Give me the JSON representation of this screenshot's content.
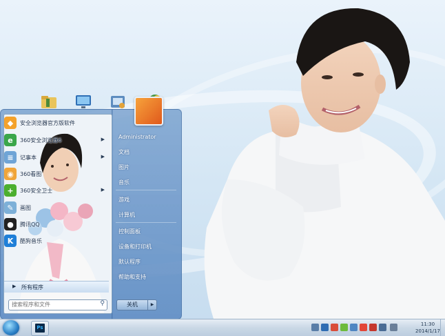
{
  "start_menu": {
    "programs": [
      {
        "label": "安全浏览器官方版软件",
        "icon": "app-store-icon",
        "color": "#f4a22b",
        "has_arrow": false
      },
      {
        "label": "360安全浏览器6",
        "icon": "browser-icon",
        "color": "#3aa64a",
        "has_arrow": true
      },
      {
        "label": "记事本",
        "icon": "notepad-icon",
        "color": "#6fa4d6",
        "has_arrow": true
      },
      {
        "label": "360看图",
        "icon": "photo-viewer-icon",
        "color": "#f0a53a",
        "has_arrow": false
      },
      {
        "label": "360安全卫士",
        "icon": "security-icon",
        "color": "#4caf2f",
        "has_arrow": true
      },
      {
        "label": "画图",
        "icon": "paint-icon",
        "color": "#7db0d8",
        "has_arrow": false
      },
      {
        "label": "腾讯QQ",
        "icon": "qq-icon",
        "color": "#222222",
        "has_arrow": false
      },
      {
        "label": "酷狗音乐",
        "icon": "kugou-icon",
        "color": "#1f7fd8",
        "has_arrow": false
      }
    ],
    "all_programs": "所有程序",
    "search_placeholder": "搜索程序和文件",
    "right_items": [
      "Administrator",
      "文档",
      "图片",
      "音乐",
      "游戏",
      "计算机",
      "控制面板",
      "设备和打印机",
      "默认程序",
      "帮助和支持"
    ],
    "shutdown": "关机"
  },
  "taskbar": {
    "ps_label": "Ps",
    "time": "11:30",
    "date": "2014/1/17",
    "tray_icons": [
      {
        "icon": "volume-icon",
        "color": "#5a7ea8"
      },
      {
        "icon": "help-icon",
        "color": "#2f6db3"
      },
      {
        "icon": "flag-icon",
        "color": "#d94d3a"
      },
      {
        "icon": "360-tray-icon",
        "color": "#6dbb3c"
      },
      {
        "icon": "network-icon",
        "color": "#4f86c2"
      },
      {
        "icon": "qq-tray-icon",
        "color": "#e24638"
      },
      {
        "icon": "shield-tray-icon",
        "color": "#c5372d"
      },
      {
        "icon": "monitor-tray-icon",
        "color": "#4a6c95"
      },
      {
        "icon": "speaker-icon",
        "color": "#6a7f99"
      }
    ]
  }
}
